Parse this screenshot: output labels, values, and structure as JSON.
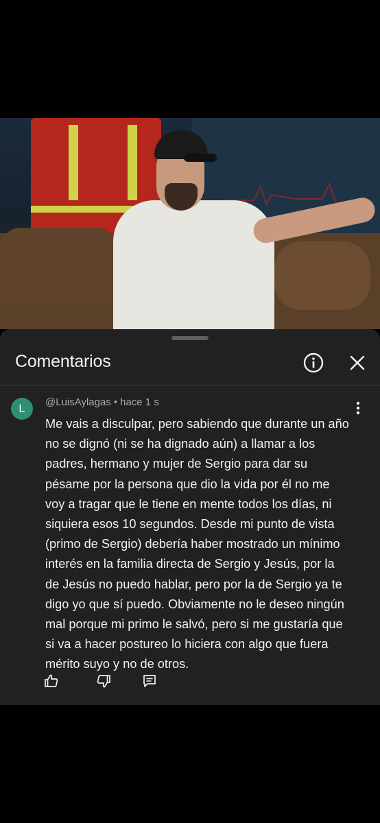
{
  "video": {
    "description_icon": "video-frame"
  },
  "sheet": {
    "title": "Comentarios",
    "info_icon": "info-icon",
    "close_icon": "close-icon"
  },
  "comment": {
    "avatar_letter": "L",
    "avatar_color": "#2f8f72",
    "author": "@LuisAylagas",
    "separator": "•",
    "time": "hace 1 s",
    "text": "Me vais a disculpar, pero sabiendo que durante un año no se dignó (ni se ha dignado aún) a llamar a los padres, hermano y mujer de Sergio para dar su pésame por la persona que dio la vida por él no me voy a tragar que le tiene en mente todos los días, ni siquiera esos 10 segundos. Desde mi punto de vista (primo de Sergio) debería haber mostrado un mínimo interés en la familia directa de Sergio y Jesús, por la de Jesús no puedo hablar, pero por la de Sergio ya te digo yo que sí puedo. Obviamente no le deseo ningún mal porque mi primo le salvó, pero si me gustaría que si va a hacer postureo lo hiciera con algo que fuera mérito suyo y no de otros.",
    "actions": {
      "like_icon": "thumbs-up-icon",
      "dislike_icon": "thumbs-down-icon",
      "reply_icon": "reply-icon"
    }
  },
  "colors": {
    "sheet_bg": "#212121",
    "text_primary": "#f1f1f1",
    "text_secondary": "#aaaaaa"
  }
}
